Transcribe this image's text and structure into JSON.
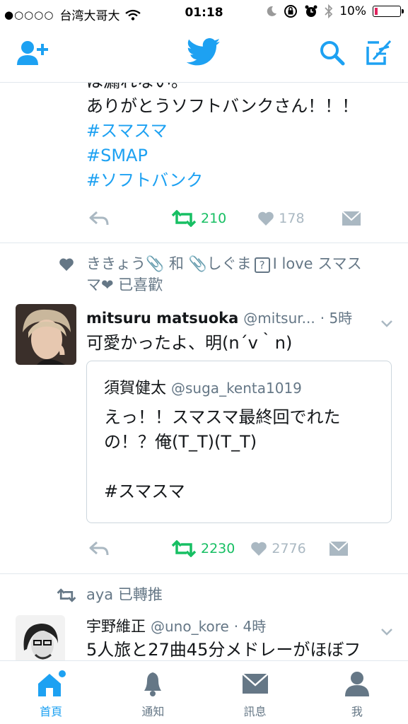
{
  "status_bar": {
    "signal_dots": "●○○○○",
    "carrier": "台湾大哥大",
    "time": "01:18",
    "battery": "10%",
    "battery_level": 0.1
  },
  "nav": {
    "icons": [
      "add-user-icon",
      "twitter-bird-icon",
      "search-icon",
      "compose-icon"
    ],
    "accent": "#1da1f2"
  },
  "tweet1": {
    "partial_line": "は漏れない。",
    "lines": [
      "ありがとうソフトバンクさん！！！"
    ],
    "hashtags": [
      "#スマスマ",
      "#SMAP",
      "#ソフトバンク"
    ],
    "retweets": "210",
    "likes": "178"
  },
  "tweet2": {
    "social_line1": "ききょう📎 和 📎しぐま",
    "social_badge": "?",
    "social_line1_tail": "I love スマス",
    "social_line2": "マ❤ 已喜歡",
    "name": "mitsuru matsuoka",
    "handle": "@mitsur...",
    "time": "· 5時",
    "text": "可愛かったよ、明(n´v｀n)",
    "quote": {
      "name": "須賀健太",
      "handle": "@suga_kenta1019",
      "line1": "えっ！！スマスマ最終回でれた",
      "line2": "の！？俺(T_T)(T_T)",
      "hashtag": "#スマスマ"
    },
    "retweets": "2230",
    "likes": "2776"
  },
  "tweet3": {
    "social": "aya 已轉推",
    "name": "宇野維正",
    "handle": "@uno_kore",
    "time": "· 4時",
    "text": "5人旅と27曲45分メドレーがほぼフ"
  },
  "tabbar": {
    "tabs": [
      {
        "label": "首頁",
        "icon": "home-icon",
        "active": true
      },
      {
        "label": "通知",
        "icon": "bell-icon",
        "active": false
      },
      {
        "label": "訊息",
        "icon": "envelope-icon",
        "active": false
      },
      {
        "label": "我",
        "icon": "profile-icon",
        "active": false
      }
    ]
  }
}
